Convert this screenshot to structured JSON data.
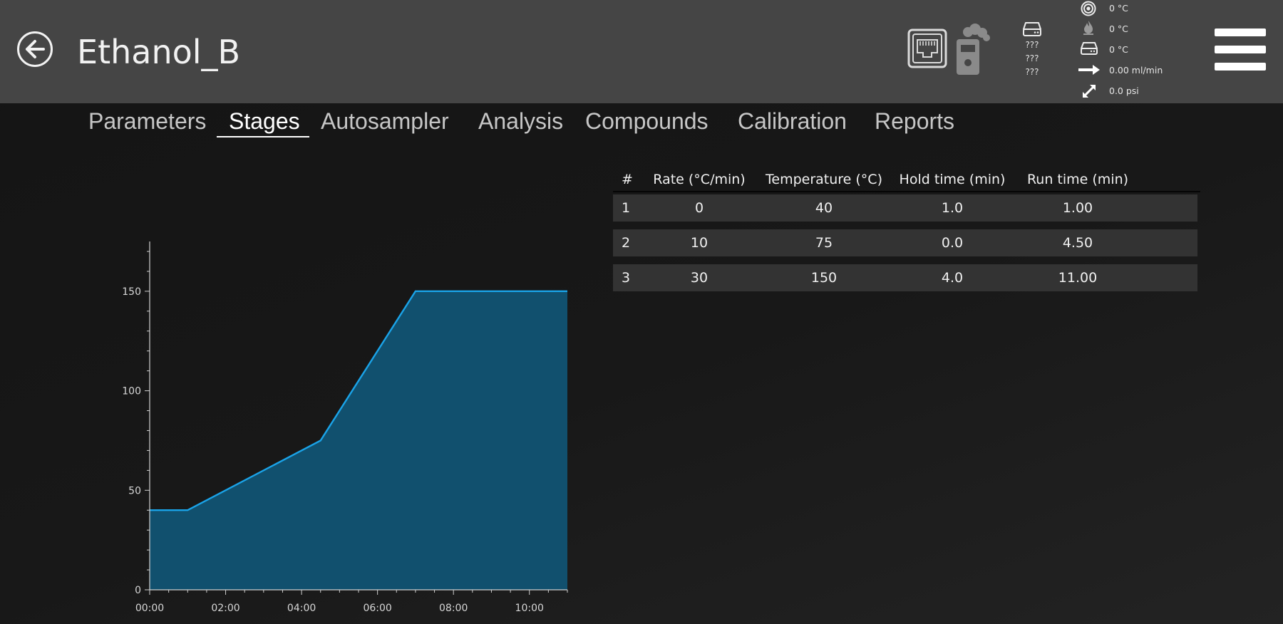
{
  "header": {
    "title": "Ethanol_B",
    "device_status": [
      "???",
      "???",
      "???"
    ],
    "readings": {
      "column_temp": "0 °C",
      "injector_temp": "0 °C",
      "detector_temp": "0 °C",
      "flow": "0.00 ml/min",
      "pressure": "0.0  psi"
    }
  },
  "tabs": [
    {
      "label": "Parameters",
      "active": false
    },
    {
      "label": "Stages",
      "active": true
    },
    {
      "label": "Autosampler",
      "active": false
    },
    {
      "label": "Analysis",
      "active": false
    },
    {
      "label": "Compounds",
      "active": false
    },
    {
      "label": "Calibration",
      "active": false
    },
    {
      "label": "Reports",
      "active": false
    }
  ],
  "table": {
    "headers": [
      "#",
      "Rate (°C/min)",
      "Temperature (°C)",
      "Hold time (min)",
      "Run time (min)"
    ],
    "rows": [
      [
        "1",
        "0",
        "40",
        "1.0",
        "1.00"
      ],
      [
        "2",
        "10",
        "75",
        "0.0",
        "4.50"
      ],
      [
        "3",
        "30",
        "150",
        "4.0",
        "11.00"
      ]
    ]
  },
  "chart_data": {
    "type": "area",
    "x": [
      0,
      1,
      4.5,
      7,
      11
    ],
    "y": [
      40,
      40,
      75,
      150,
      150
    ],
    "xlim": [
      0,
      11
    ],
    "ylim": [
      0,
      175
    ],
    "x_ticks": [
      0,
      2,
      4,
      6,
      8,
      10
    ],
    "x_tick_labels": [
      "00:00",
      "02:00",
      "04:00",
      "06:00",
      "08:00",
      "10:00"
    ],
    "y_ticks": [
      0,
      50,
      100,
      150
    ],
    "y_tick_labels": [
      "0",
      "50",
      "100",
      "150"
    ],
    "grid": false,
    "line_color": "#1aa3e8",
    "fill_color": "#11506e"
  }
}
